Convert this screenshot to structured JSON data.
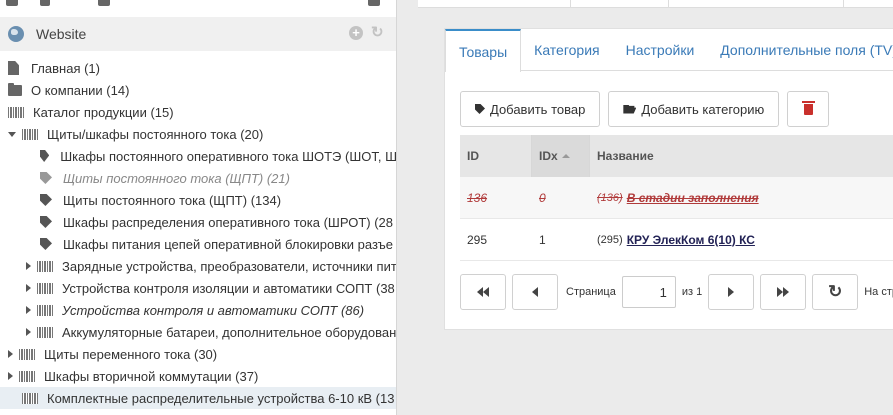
{
  "site": {
    "title": "Website"
  },
  "tree": [
    {
      "label": "Главная (1)",
      "icon": "file",
      "depth": 0,
      "toggle": "none"
    },
    {
      "label": "О компании (14)",
      "icon": "folder",
      "depth": 0,
      "toggle": "none"
    },
    {
      "label": "Каталог продукции (15)",
      "icon": "barcode",
      "depth": 0,
      "toggle": "none"
    },
    {
      "label": "Щиты/шкафы постоянного тока (20)",
      "icon": "barcode",
      "depth": 1,
      "toggle": "open"
    },
    {
      "label": "Шкафы постоянного оперативного тока ШОТЭ (ШОТ, Ш",
      "icon": "tag",
      "depth": 2,
      "toggle": "none"
    },
    {
      "label": "Щиты постоянного тока (ЩПТ) (21)",
      "icon": "tag",
      "depth": 2,
      "toggle": "none",
      "style": "dim"
    },
    {
      "label": "Щиты постоянного тока (ЩПТ) (134)",
      "icon": "tag",
      "depth": 2,
      "toggle": "none"
    },
    {
      "label": "Шкафы распределения оперативного тока (ШРОТ) (28",
      "icon": "tag",
      "depth": 2,
      "toggle": "none"
    },
    {
      "label": "Шкафы питания цепей оперативной блокировки разъе",
      "icon": "tag",
      "depth": 2,
      "toggle": "none"
    },
    {
      "label": "Зарядные устройства, преобразователи, источники пит",
      "icon": "barcode",
      "depth": 2,
      "toggle": "closed"
    },
    {
      "label": "Устройства контроля изоляции и автоматики СОПТ (38",
      "icon": "barcode",
      "depth": 2,
      "toggle": "closed"
    },
    {
      "label": "Устройства контроля и автоматики СОПТ (86)",
      "icon": "barcode",
      "depth": 2,
      "toggle": "closed",
      "style": "ital"
    },
    {
      "label": "Аккумуляторные батареи, дополнительное оборудован",
      "icon": "barcode",
      "depth": 2,
      "toggle": "closed"
    },
    {
      "label": "Щиты переменного тока (30)",
      "icon": "barcode",
      "depth": 1,
      "toggle": "closed"
    },
    {
      "label": "Шкафы вторичной коммутации (37)",
      "icon": "barcode",
      "depth": 1,
      "toggle": "closed"
    },
    {
      "label": "Комплектные распределительные устройства 6-10 кВ (13",
      "icon": "barcode",
      "depth": 1,
      "toggle": "none",
      "style": "sel"
    }
  ],
  "tabs": [
    {
      "label": "Товары",
      "active": true
    },
    {
      "label": "Категория",
      "active": false
    },
    {
      "label": "Настройки",
      "active": false
    },
    {
      "label": "Дополнительные поля (TV)",
      "active": false
    }
  ],
  "toolbar": {
    "add_product": "Добавить товар",
    "add_category": "Добавить категорию"
  },
  "grid": {
    "columns": {
      "id": "ID",
      "idx": "IDx",
      "name": "Название"
    },
    "rows": [
      {
        "id": "136",
        "idx": "0",
        "code": "(136)",
        "name": "В стадии заполнения",
        "struck": true
      },
      {
        "id": "295",
        "idx": "1",
        "code": "(295)",
        "name": "КРУ ЭлекКом 6(10) КС",
        "struck": false
      }
    ]
  },
  "pager": {
    "page_label": "Страница",
    "page_value": "1",
    "of_label": "из 1",
    "per_page_label": "На стр"
  },
  "colors": {
    "accent": "#3a8dc9",
    "link": "#3a7ab7",
    "danger": "#c9302c"
  }
}
